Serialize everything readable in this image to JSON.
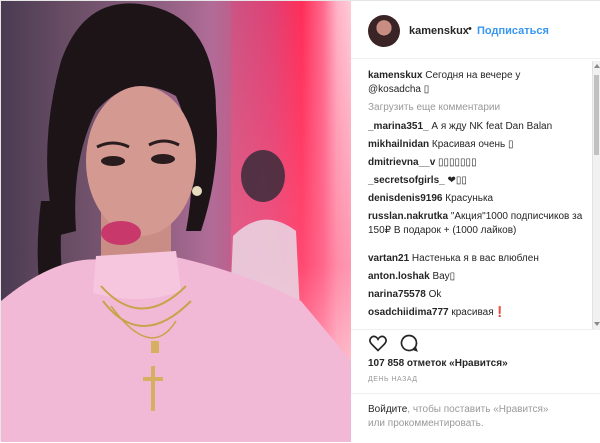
{
  "header": {
    "username": "kamenskux",
    "separator": "•",
    "follow_label": "Подписаться"
  },
  "caption": {
    "username": "kamenskux",
    "text": "Сегодня на вечере у",
    "mention": "@kosadcha",
    "emoji": "▯"
  },
  "load_more": "Загрузить еще комментарии",
  "comments": [
    {
      "user": "_marina351_",
      "text": "А я жду NK feat Dan Balan"
    },
    {
      "user": "mikhailnidan",
      "text": "Красивая очень ▯"
    },
    {
      "user": "dmitrievna__v",
      "text": "▯▯▯▯▯▯▯"
    },
    {
      "user": "_secretsofgirls_",
      "text": "❤▯▯"
    },
    {
      "user": "denisdenis9196",
      "text": "Красунька"
    },
    {
      "user": "russlan.nakrutka",
      "text": "\"Акция\"1000 подписчиков за 150₽ В подарок + (1000 лайков)"
    },
    {
      "user": "vartan21",
      "text": "Настенька я в вас влюблен"
    },
    {
      "user": "anton.loshak",
      "text": "Вау▯"
    },
    {
      "user": "narina75578",
      "text": "Ok"
    },
    {
      "user": "osadchiidima777",
      "text": "красивая❗"
    }
  ],
  "likes": "107 858 отметок «Нравится»",
  "time": "ДЕНЬ НАЗАД",
  "footer": {
    "login_link": "Войдите",
    "text1": ", чтобы поставить «Нравится»",
    "text2": "или прокомментировать."
  },
  "icons": {
    "like": "heart-icon",
    "comment": "comment-icon"
  }
}
